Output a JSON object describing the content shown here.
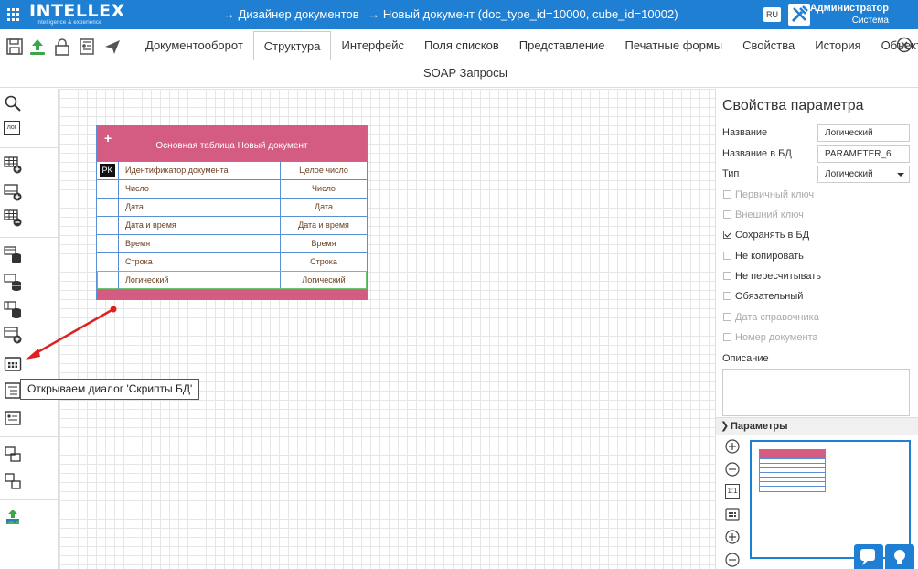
{
  "app": {
    "logo_text": "INTELLEX",
    "logo_tagline": "intelligence & experience",
    "breadcrumbs": [
      "→ Дизайнер документов",
      "→ Новый документ (doc_type_id=10000, cube_id=10002)"
    ],
    "language": "RU",
    "user_name": "Администратор",
    "user_role": "Система"
  },
  "tabs": [
    "Документооборот",
    "Структура",
    "Интерфейс",
    "Поля списков",
    "Представление",
    "Печатные формы",
    "Свойства",
    "История",
    "Объекты"
  ],
  "active_tab": "Структура",
  "tab_row2": "SOAP Запросы",
  "leftbar": {
    "log_label": "лог"
  },
  "table": {
    "title": "Основная таблица Новый документ",
    "pk_label": "PK",
    "rows": [
      {
        "name": "Идентификатор документа",
        "type": "Целое число"
      },
      {
        "name": "Число",
        "type": "Число"
      },
      {
        "name": "Дата",
        "type": "Дата"
      },
      {
        "name": "Дата и время",
        "type": "Дата и время"
      },
      {
        "name": "Время",
        "type": "Время"
      },
      {
        "name": "Строка",
        "type": "Строка"
      },
      {
        "name": "Логический",
        "type": "Логический"
      }
    ]
  },
  "tooltip": "Открываем диалог 'Скрипты БД'",
  "props": {
    "title": "Свойства параметра",
    "name_label": "Название",
    "name_value": "Логический",
    "dbname_label": "Название в БД",
    "dbname_value": "PARAMETER_6",
    "type_label": "Тип",
    "type_value": "Логический",
    "checkboxes": [
      {
        "label": "Первичный ключ",
        "checked": false,
        "disabled": true
      },
      {
        "label": "Внешний ключ",
        "checked": false,
        "disabled": true
      },
      {
        "label": "Сохранять в БД",
        "checked": true,
        "disabled": false
      },
      {
        "label": "Не копировать",
        "checked": false,
        "disabled": false
      },
      {
        "label": "Не пересчитывать",
        "checked": false,
        "disabled": false
      },
      {
        "label": "Обязательный",
        "checked": false,
        "disabled": false
      },
      {
        "label": "Дата справочника",
        "checked": false,
        "disabled": true
      },
      {
        "label": "Номер документа",
        "checked": false,
        "disabled": true
      }
    ],
    "desc_label": "Описание",
    "params_label": "Параметры"
  },
  "zoom": {
    "reset_label": "1:1"
  },
  "colors": {
    "accent": "#1f7fd3",
    "table_header": "#d45b82",
    "annotation_arrow": "#e02020"
  }
}
